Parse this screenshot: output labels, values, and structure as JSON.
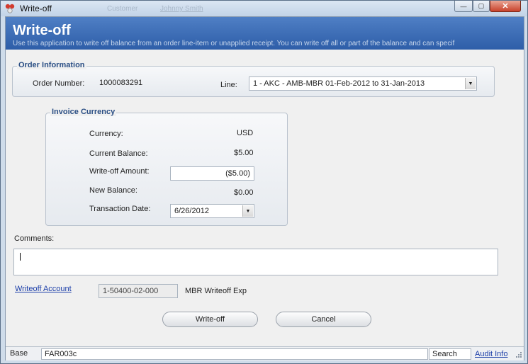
{
  "window": {
    "title": "Write-off",
    "ghost_text_1": "Customer",
    "ghost_text_2": "Johnny Smith",
    "minimize_symbol": "—",
    "maximize_symbol": "▢",
    "close_symbol": "✕"
  },
  "header": {
    "title": "Write-off",
    "description": "Use this application to write off balance from an order line-item or unapplied receipt. You can write off all or part of the balance and can specif"
  },
  "order_info": {
    "group_title": "Order Information",
    "order_number_label": "Order Number:",
    "order_number_value": "1000083291",
    "line_label": "Line:",
    "line_value": "1 - AKC - AMB-MBR 01-Feb-2012 to 31-Jan-2013"
  },
  "invoice": {
    "group_title": "Invoice Currency",
    "currency_label": "Currency:",
    "currency_value": "USD",
    "current_balance_label": "Current Balance:",
    "current_balance_value": "$5.00",
    "writeoff_amount_label": "Write-off Amount:",
    "writeoff_amount_value": "($5.00)",
    "new_balance_label": "New Balance:",
    "new_balance_value": "$0.00",
    "transaction_date_label": "Transaction Date:",
    "transaction_date_value": "6/26/2012"
  },
  "comments": {
    "label": "Comments:",
    "value": ""
  },
  "account": {
    "link_label": "Writeoff Account",
    "account_code": "1-50400-02-000",
    "account_name": "MBR Writeoff Exp"
  },
  "actions": {
    "writeoff_label": "Write-off",
    "cancel_label": "Cancel"
  },
  "statusbar": {
    "base_label": "Base",
    "form_code": "FAR003c",
    "search_label": "Search",
    "audit_info_label": "Audit Info"
  },
  "icons": {
    "app": "app-logo-icon",
    "dropdown": "chevron-down-icon"
  }
}
